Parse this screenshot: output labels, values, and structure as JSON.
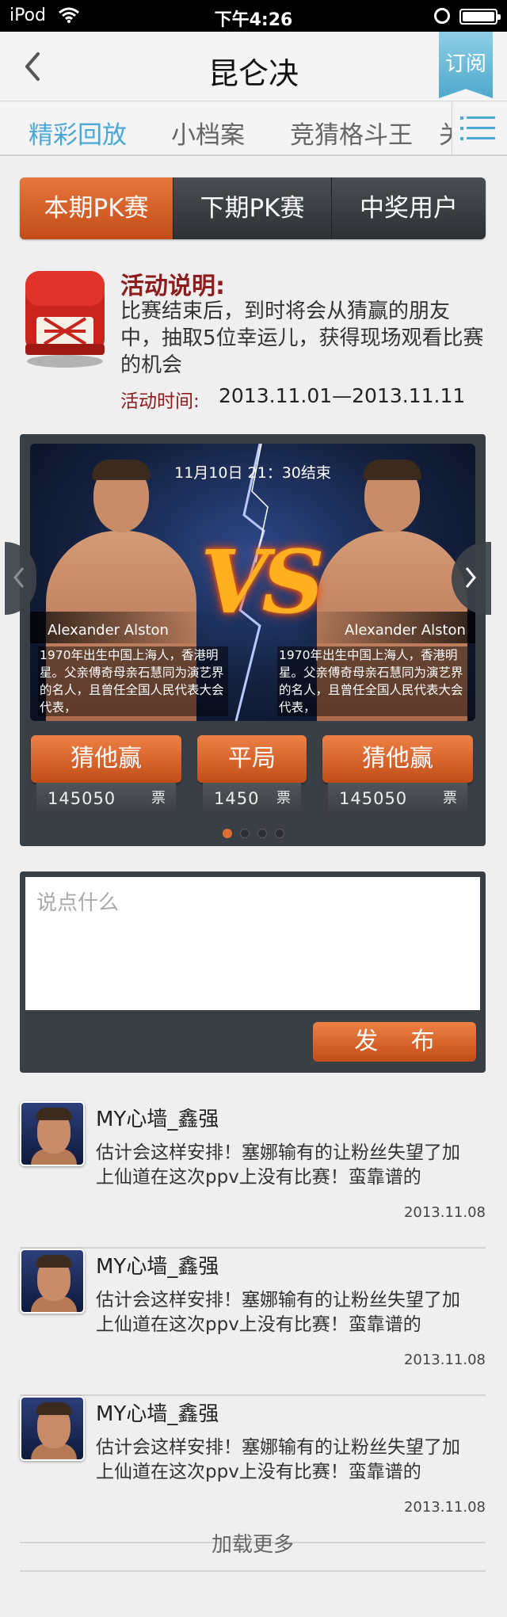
{
  "status_bar": {
    "carrier": "iPod",
    "time": "下午4:26"
  },
  "nav": {
    "title": "昆仑决",
    "subscribe_label": "订阅"
  },
  "tabs": [
    {
      "label": "精彩回放",
      "active": true
    },
    {
      "label": "小档案",
      "active": false
    },
    {
      "label": "竞猜格斗王",
      "active": false
    },
    {
      "label": "关",
      "active": false
    }
  ],
  "segments": [
    {
      "label": "本期PK赛",
      "active": true
    },
    {
      "label": "下期PK赛",
      "active": false
    },
    {
      "label": "中奖用户",
      "active": false
    }
  ],
  "activity": {
    "title": "活动说明:",
    "description": "比赛结束后，到时将会从猜赢的朋友中，抽取5位幸运儿，获得现场观看比赛的机会",
    "time_label": "活动时间:",
    "time_value": "2013.11.01—2013.11.11"
  },
  "match": {
    "end_time": "11月10日  21：30结束",
    "vs_text": "VS",
    "fighter_left": {
      "name": "Alexander  Alston",
      "bio": "1970年出生中国上海人，香港明星。父亲傅奇母亲石慧同为演艺界的名人，且曾任全国人民代表大会代表，"
    },
    "fighter_right": {
      "name": "Alexander  Alston",
      "bio": "1970年出生中国上海人，香港明星。父亲傅奇母亲石慧同为演艺界的名人，且曾任全国人民代表大会代表，"
    },
    "votes": [
      {
        "label": "猜他赢",
        "count": "145050",
        "unit": "票"
      },
      {
        "label": "平局",
        "count": "1450",
        "unit": "票"
      },
      {
        "label": "猜他赢",
        "count": "145050",
        "unit": "票"
      }
    ],
    "page_count": 4,
    "current_page": 1
  },
  "comment_form": {
    "placeholder": "说点什么",
    "publish_label": "发 布"
  },
  "comments": [
    {
      "user": "MY心墙_鑫强",
      "text": "估计会这样安排！塞娜输有的让粉丝失望了加上仙道在这次ppv上没有比赛！蛮靠谱的",
      "date": "2013.11.08"
    },
    {
      "user": "MY心墙_鑫强",
      "text": "估计会这样安排！塞娜输有的让粉丝失望了加上仙道在这次ppv上没有比赛！蛮靠谱的",
      "date": "2013.11.08"
    },
    {
      "user": "MY心墙_鑫强",
      "text": "估计会这样安排！塞娜输有的让粉丝失望了加上仙道在这次ppv上没有比赛！蛮靠谱的",
      "date": "2013.11.08"
    }
  ],
  "load_more": "加载更多",
  "colors": {
    "accent_orange": "#d9612a",
    "tab_blue": "#4aa7d6",
    "activity_red": "#8d1c1c",
    "card_dark": "#3a3f45"
  }
}
